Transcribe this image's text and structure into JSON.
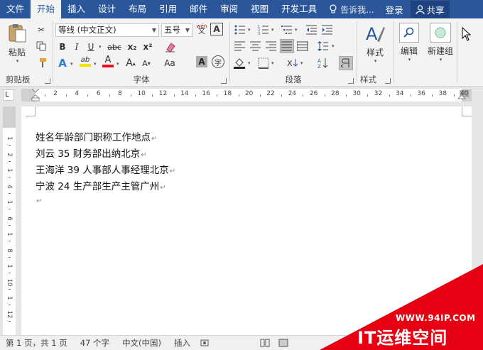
{
  "menu": {
    "tabs": [
      "文件",
      "开始",
      "插入",
      "设计",
      "布局",
      "引用",
      "邮件",
      "审阅",
      "视图",
      "开发工具"
    ],
    "active_tab": "开始",
    "tell_me": "告诉我...",
    "login": "登录",
    "share": "共享"
  },
  "ribbon": {
    "clipboard": {
      "label": "剪贴板",
      "paste_label": "粘贴"
    },
    "font": {
      "label": "字体",
      "font_name": "等线 (中文正文)",
      "font_size": "五号",
      "phonetic_top": "wén",
      "phonetic_bottom": "文",
      "char_border": "A",
      "bold": "B",
      "italic": "I",
      "underline": "U",
      "strike": "abc",
      "subscript": "x₂",
      "superscript": "x²",
      "effects": "A",
      "highlight": "ab",
      "font_color": "A",
      "grow": "A",
      "shrink": "A",
      "aa": "Aa",
      "shading": "A",
      "enclose": "字"
    },
    "paragraph": {
      "label": "段落"
    },
    "styles": {
      "label": "样式",
      "styles_button": "样式"
    },
    "editing": {
      "edit_button": "编辑"
    },
    "newgroup": {
      "button": "新建组"
    },
    "colors": {
      "highlight": "#f4e200",
      "font_color": "#e81123",
      "accent": "#2b579a"
    }
  },
  "ruler": {
    "corner": "L",
    "ticks": [
      "2",
      "4",
      "6",
      "8",
      "10",
      "12",
      "14",
      "16",
      "18",
      "20",
      "22",
      "24",
      "26",
      "28",
      "30",
      "32",
      "34",
      "36",
      "38",
      "40"
    ],
    "vticks": [
      "1",
      "2",
      "1",
      "4",
      "1",
      "6",
      "1",
      "8",
      "1",
      "10",
      "1",
      "12"
    ]
  },
  "document": {
    "lines": [
      "姓名年龄部门职称工作地点",
      "刘云 35 财务部出纳北京",
      "王海洋 39 人事部人事经理北京",
      "宁波 24 生产部生产主管广州",
      ""
    ],
    "paragraph_mark": "↵"
  },
  "status": {
    "page": "第 1 页，共 1 页",
    "words": "47 个字",
    "language": "中文(中国)",
    "mode": "插入"
  },
  "watermark": {
    "url": "WWW.94IP.COM",
    "name": "IT运维空间",
    "color": "#e60012"
  }
}
